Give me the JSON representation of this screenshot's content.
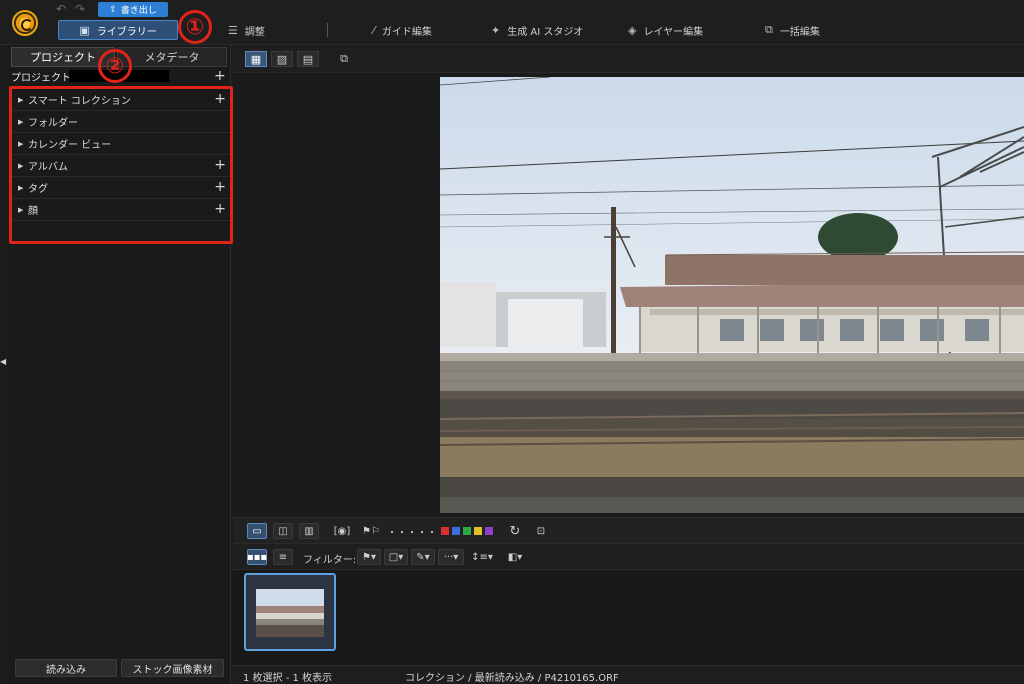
{
  "topbar": {
    "undo_icon": "undo-arrow-icon",
    "redo_icon": "redo-arrow-icon",
    "export_label": "書き出し",
    "modes": [
      {
        "id": "library",
        "label": "ライブラリー",
        "icon": "library-icon",
        "active": true
      },
      {
        "id": "adjust",
        "label": "調整",
        "icon": "sliders-icon"
      },
      {
        "id": "guided-edit",
        "label": "ガイド編集",
        "icon": "magic-wand-icon"
      },
      {
        "id": "gen-ai-studio",
        "label": "生成 AI スタジオ",
        "icon": "sparkle-icon"
      },
      {
        "id": "layer-edit",
        "label": "レイヤー編集",
        "icon": "layers-icon"
      },
      {
        "id": "batch-edit",
        "label": "一括編集",
        "icon": "batch-icon"
      }
    ],
    "accent_color": "#2d7fd6"
  },
  "callouts": {
    "one": "①",
    "two": "②",
    "color": "#e2231a"
  },
  "left_panel": {
    "tabs": [
      {
        "label": "プロジェクト",
        "active": true
      },
      {
        "label": "メタデータ",
        "active": false
      }
    ],
    "project_title": "プロジェクト",
    "tree_items": [
      {
        "label": "スマート コレクション",
        "addable": true
      },
      {
        "label": "フォルダー",
        "addable": false
      },
      {
        "label": "カレンダー ビュー",
        "addable": false
      },
      {
        "label": "アルバム",
        "addable": true
      },
      {
        "label": "タグ",
        "addable": true
      },
      {
        "label": "顔",
        "addable": true
      }
    ],
    "import_label": "読み込み",
    "stock_label": "ストック画像素材"
  },
  "filmstrip_toolbar": {
    "filter_label": "フィルター:",
    "color_labels": [
      "#d63030",
      "#3a6fd8",
      "#2fa84a",
      "#e2c22a",
      "#8f3fc8"
    ],
    "rating_dots": "・・・・・"
  },
  "status": {
    "selection": "1 枚選択 - 1 枚表示",
    "path": "コレクション / 最新読み込み / P4210165.ORF"
  }
}
